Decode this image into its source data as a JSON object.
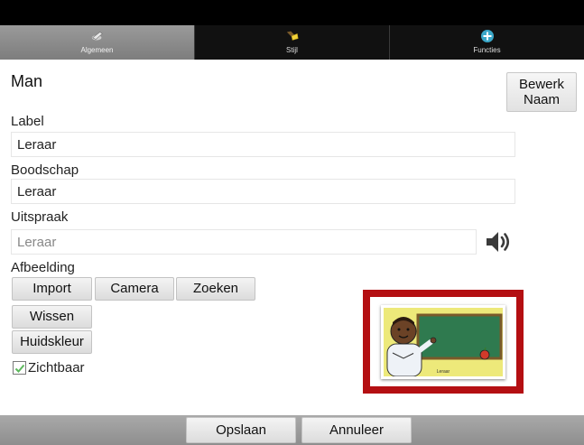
{
  "tabs": [
    {
      "label": "Algemeen",
      "icon": "edit-pencil-icon",
      "active": true
    },
    {
      "label": "Stijl",
      "icon": "paint-brush-icon",
      "active": false
    },
    {
      "label": "Functies",
      "icon": "plus-circle-icon",
      "active": false
    }
  ],
  "header": {
    "title": "Man",
    "edit_name_label_line1": "Bewerk",
    "edit_name_label_line2": "Naam"
  },
  "fields": {
    "label": {
      "title": "Label",
      "value": "Leraar"
    },
    "message": {
      "title": "Boodschap",
      "value": "Leraar"
    },
    "pronunciation": {
      "title": "Uitspraak",
      "placeholder": "Leraar"
    }
  },
  "image_section": {
    "title": "Afbeelding",
    "import_label": "Import",
    "camera_label": "Camera",
    "search_label": "Zoeken",
    "clear_label": "Wissen",
    "skin_color_label": "Huidskleur",
    "visible_label": "Zichtbaar",
    "visible_checked": true,
    "preview_caption": "Leraar",
    "frame_color": "#b40f12"
  },
  "footer": {
    "save_label": "Opslaan",
    "cancel_label": "Annuleer"
  }
}
